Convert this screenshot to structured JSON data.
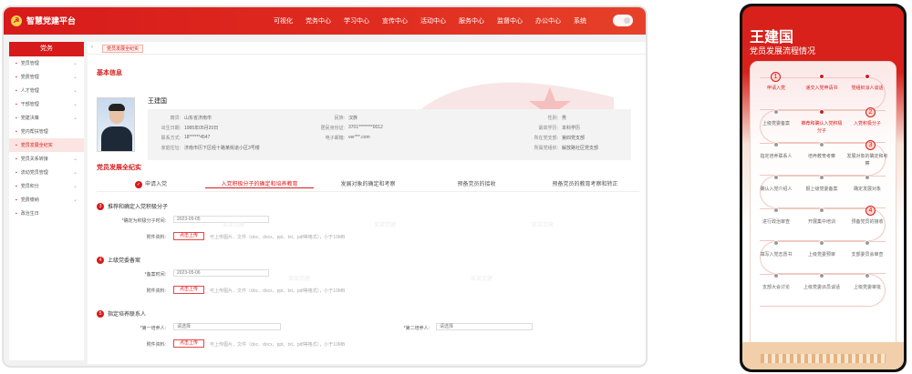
{
  "desktop": {
    "brand": "智慧党建平台",
    "nav": [
      "可视化",
      "党务中心",
      "学习中心",
      "宣传中心",
      "活动中心",
      "服务中心",
      "监督中心",
      "办公中心",
      "系统"
    ],
    "sidebar_header": "党务",
    "sidebar": [
      "党员管理",
      "党费管理",
      "人才管理",
      "干部管理",
      "党建决策",
      "党内帮扶管理",
      "党员发展全纪实",
      "党员关系转接",
      "流动党员管理",
      "党员积分",
      "党费缴纳",
      "政治生日"
    ],
    "active_sidebar_index": 6,
    "breadcrumb_tab": "党员发展全纪实",
    "basic_info_title": "基本信息",
    "person": {
      "name": "王建国",
      "fields": [
        {
          "label": "籍贯:",
          "value": "山东省济南市"
        },
        {
          "label": "出生日期:",
          "value": "1985年05月20日"
        },
        {
          "label": "联系方式:",
          "value": "18******4547"
        },
        {
          "label": "家庭住址:",
          "value": "济南市历下区经十路某街道小区3号楼"
        },
        {
          "label": "民族:",
          "value": "汉族"
        },
        {
          "label": "居民身份证:",
          "value": "3701********0012"
        },
        {
          "label": "电子邮箱:",
          "value": "ver***.com"
        },
        {
          "label": "性别:",
          "value": "男"
        },
        {
          "label": "最高学历:",
          "value": "本科学历"
        },
        {
          "label": "所在党支部:",
          "value": "第四党支部"
        },
        {
          "label": "所属党组织:",
          "value": "解放路社区党支部"
        }
      ]
    },
    "progress_title": "党员发展全纪实",
    "steps": [
      "申请入党",
      "入党积极分子的确定和培养教育",
      "发展对象的确定和考察",
      "预备党员的接收",
      "预备党员的教育考察和转正"
    ],
    "forms": [
      {
        "num": "3",
        "title": "推荐和确定入党积极分子",
        "field": "*确定为积极分子时间:",
        "value": "2023-05-05",
        "upload_label": "附件资料:",
        "button": "点击上传",
        "hint": "可上传图片、文件（doc、docx、ppt、txt、pdf等格式），小于10MB"
      },
      {
        "num": "4",
        "title": "上级党委备案",
        "field": "*备案时间:",
        "value": "2023-05-06",
        "upload_label": "附件资料:",
        "button": "点击上传",
        "hint": "可上传图片、文件（doc、docx、ppt、txt、pdf等格式），小于10MB"
      },
      {
        "num": "5",
        "title": "指定培养联系人",
        "field": "*第一培养人:",
        "value": "请选择",
        "field2": "*第二培养人:",
        "value2": "请选择",
        "upload_label": "附件资料:",
        "button": "点击上传",
        "hint": "可上传图片、文件（doc、docx、ppt、txt、pdf等格式），小于10MB"
      }
    ],
    "watermark": "某某党建"
  },
  "mobile": {
    "name": "王建国",
    "subtitle": "党员发展流程情况",
    "steps": [
      {
        "label": "申请入党",
        "state": "current",
        "num": "1"
      },
      {
        "label": "递交入党申请书",
        "state": "active"
      },
      {
        "label": "党组织派人谈话",
        "state": "active"
      },
      {
        "label": "入党积极分子",
        "state": "current",
        "num": "2"
      },
      {
        "label": "推荐和确认入党积极分子",
        "state": "active"
      },
      {
        "label": "上级党委备案",
        "state": "normal"
      },
      {
        "label": "指定培养联系人",
        "state": "normal"
      },
      {
        "label": "培养教育考察",
        "state": "normal"
      },
      {
        "label": "发展对象的确定和考察",
        "state": "current",
        "num": "3"
      },
      {
        "label": "确定发展对象",
        "state": "normal"
      },
      {
        "label": "报上级党委备案",
        "state": "normal"
      },
      {
        "label": "确认入党介绍人",
        "state": "normal"
      },
      {
        "label": "进行政治审查",
        "state": "normal"
      },
      {
        "label": "开展集中培训",
        "state": "normal"
      },
      {
        "label": "预备党员的接收",
        "state": "current",
        "num": "4"
      },
      {
        "label": "支部委员会审查",
        "state": "normal"
      },
      {
        "label": "上级党委预审",
        "state": "normal"
      },
      {
        "label": "填写入党志愿书",
        "state": "normal"
      },
      {
        "label": "支部大会讨论",
        "state": "normal"
      },
      {
        "label": "上级党委派员谈话",
        "state": "normal"
      },
      {
        "label": "上级党委审批",
        "state": "normal"
      }
    ]
  },
  "colors": {
    "primary": "#d71a1a",
    "secondary": "#f2b0a5",
    "muted": "#888888"
  }
}
